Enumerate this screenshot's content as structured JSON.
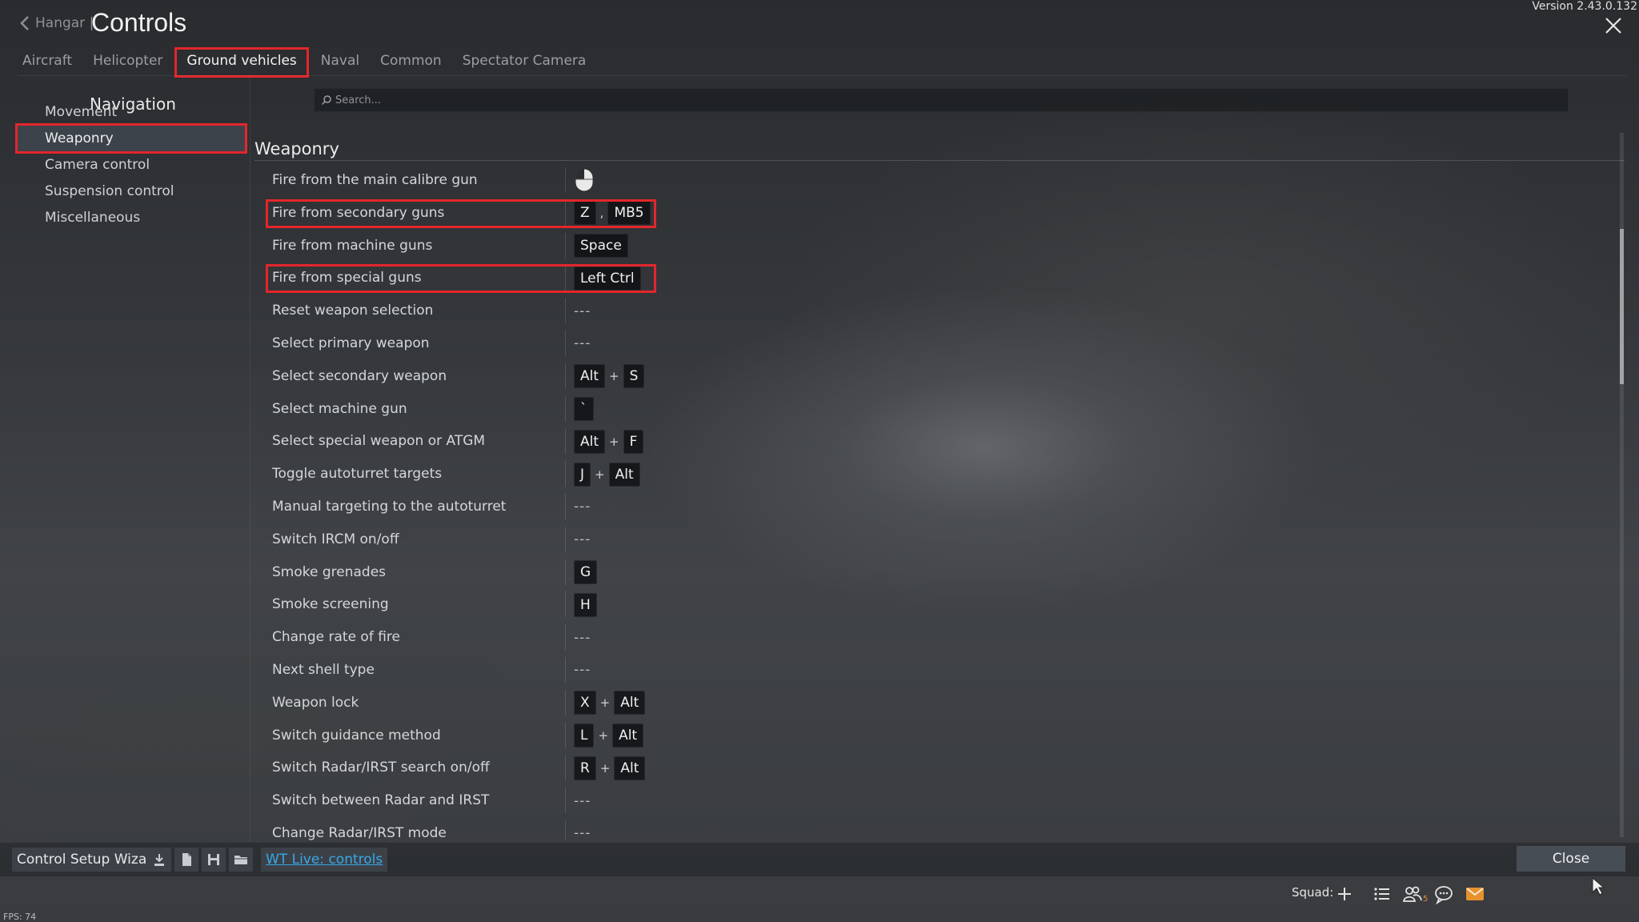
{
  "header": {
    "back_label": "Hangar |",
    "title": "Controls",
    "version": "Version 2.43.0.132"
  },
  "tabs": [
    {
      "label": "Aircraft"
    },
    {
      "label": "Helicopter"
    },
    {
      "label": "Ground vehicles",
      "active": true
    },
    {
      "label": "Naval"
    },
    {
      "label": "Common"
    },
    {
      "label": "Spectator Camera"
    }
  ],
  "nav": {
    "title": "Navigation",
    "items": [
      {
        "label": "Movement"
      },
      {
        "label": "Weaponry",
        "active": true
      },
      {
        "label": "Camera control"
      },
      {
        "label": "Suspension control"
      },
      {
        "label": "Miscellaneous"
      }
    ]
  },
  "search": {
    "placeholder": "Search..."
  },
  "section": {
    "title": "Weaponry",
    "rows": [
      {
        "label": "Fire from the main calibre gun",
        "binding": "mouse-left-button-icon"
      },
      {
        "label": "Fire from secondary guns",
        "keys": [
          "Z",
          ",",
          "MB5"
        ],
        "highlighted": true
      },
      {
        "label": "Fire from machine guns",
        "keys": [
          "Space"
        ]
      },
      {
        "label": "Fire from special guns",
        "keys": [
          "Left Ctrl"
        ],
        "highlighted": true
      },
      {
        "label": "Reset weapon selection",
        "keys": [
          "---"
        ]
      },
      {
        "label": "Select primary weapon",
        "keys": [
          "---"
        ]
      },
      {
        "label": "Select secondary weapon",
        "keys": [
          "Alt",
          "+",
          "S"
        ]
      },
      {
        "label": "Select machine gun",
        "keys": [
          "`"
        ]
      },
      {
        "label": "Select special weapon or ATGM",
        "keys": [
          "Alt",
          "+",
          "F"
        ]
      },
      {
        "label": "Toggle autoturret targets",
        "keys": [
          "J",
          "+",
          "Alt"
        ]
      },
      {
        "label": "Manual targeting to the autoturret",
        "keys": [
          "---"
        ]
      },
      {
        "label": "Switch IRCM on/off",
        "keys": [
          "---"
        ]
      },
      {
        "label": "Smoke grenades",
        "keys": [
          "G"
        ]
      },
      {
        "label": "Smoke screening",
        "keys": [
          "H"
        ]
      },
      {
        "label": "Change rate of fire",
        "keys": [
          "---"
        ]
      },
      {
        "label": "Next shell type",
        "keys": [
          "---"
        ]
      },
      {
        "label": "Weapon lock",
        "keys": [
          "X",
          "+",
          "Alt"
        ]
      },
      {
        "label": "Switch guidance method",
        "keys": [
          "L",
          "+",
          "Alt"
        ]
      },
      {
        "label": "Switch Radar/IRST search on/off",
        "keys": [
          "R",
          "+",
          "Alt"
        ]
      },
      {
        "label": "Switch between Radar and IRST",
        "keys": [
          "---"
        ]
      },
      {
        "label": "Change Radar/IRST mode",
        "keys": [
          "---"
        ]
      }
    ]
  },
  "bottom": {
    "wizard_label": "Control Setup Wizard",
    "icons": [
      "import-icon",
      "new-file-icon",
      "save-icon",
      "open-folder-icon"
    ],
    "wt_live_label": "WT Live: controls",
    "close_label": "Close"
  },
  "squad_bar": {
    "label": "Squad:",
    "friends_count": "5",
    "icons": [
      "plus-icon",
      "list-icon",
      "friends-icon",
      "chat-icon",
      "mail-icon"
    ]
  },
  "fps": "FPS: 74",
  "colors": {
    "highlight": "#e3262b",
    "link": "#37a8e9",
    "mail": "#e8912f"
  }
}
